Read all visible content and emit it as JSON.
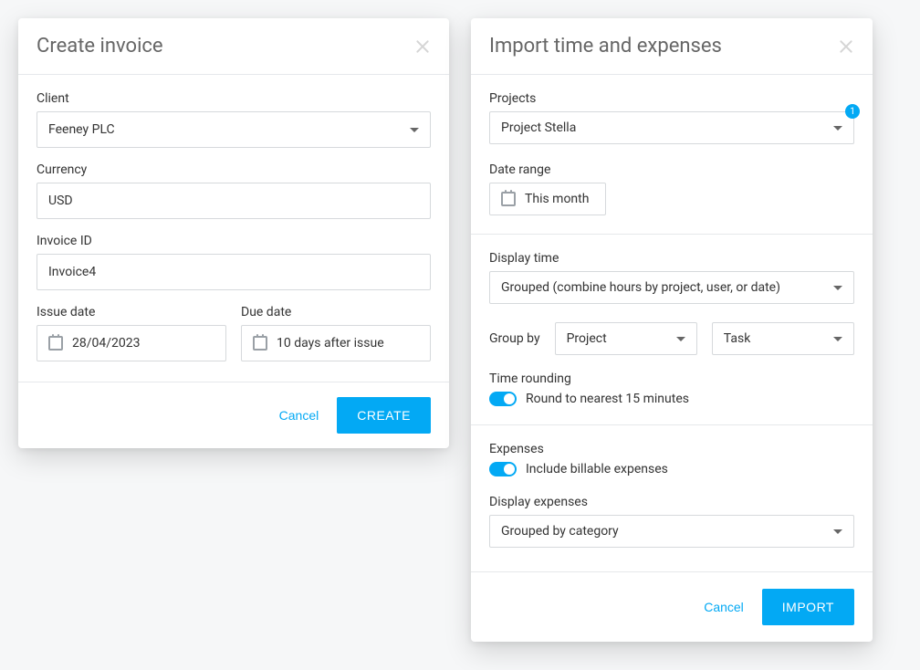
{
  "createInvoice": {
    "title": "Create invoice",
    "clientLabel": "Client",
    "clientValue": "Feeney PLC",
    "currencyLabel": "Currency",
    "currencyValue": "USD",
    "invoiceIdLabel": "Invoice ID",
    "invoiceIdValue": "Invoice4",
    "issueDateLabel": "Issue date",
    "issueDateValue": "28/04/2023",
    "dueDateLabel": "Due date",
    "dueDateValue": "10 days after issue",
    "cancelLabel": "Cancel",
    "createLabel": "CREATE"
  },
  "importPanel": {
    "title": "Import time and expenses",
    "projectsLabel": "Projects",
    "projectsValue": "Project Stella",
    "projectsBadge": "1",
    "dateRangeLabel": "Date range",
    "dateRangeValue": "This month",
    "displayTimeLabel": "Display time",
    "displayTimeValue": "Grouped (combine hours by project, user, or date)",
    "groupByLabel": "Group by",
    "groupBy1": "Project",
    "groupBy2": "Task",
    "timeRoundingLabel": "Time rounding",
    "timeRoundingValue": "Round to nearest 15 minutes",
    "expensesLabel": "Expenses",
    "expensesToggleLabel": "Include billable expenses",
    "displayExpensesLabel": "Display expenses",
    "displayExpensesValue": "Grouped by category",
    "cancelLabel": "Cancel",
    "importLabel": "IMPORT"
  }
}
